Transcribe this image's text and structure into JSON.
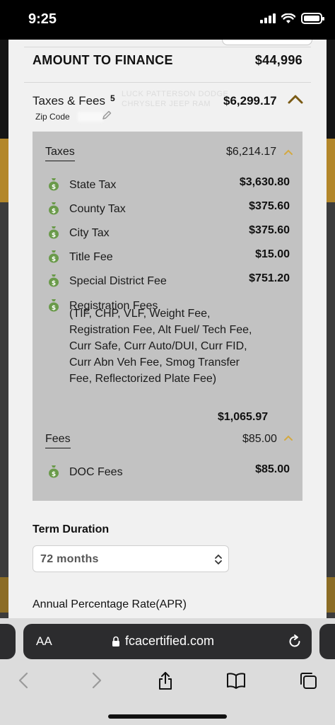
{
  "status_bar": {
    "time": "9:25"
  },
  "summary": {
    "amount_label": "AMOUNT TO FINANCE",
    "amount_value": "$44,996",
    "taxes_fees_label": "Taxes & Fees",
    "taxes_fees_count": "5",
    "taxes_fees_value": "$6,299.17",
    "zip_label": "Zip Code"
  },
  "taxes": {
    "label": "Taxes",
    "total": "$6,214.17",
    "items": [
      {
        "name": "State Tax",
        "amount": "$3,630.80"
      },
      {
        "name": "County Tax",
        "amount": "$375.60"
      },
      {
        "name": "City Tax",
        "amount": "$375.60"
      },
      {
        "name": "Title Fee",
        "amount": "$15.00"
      },
      {
        "name": "Special District Fee",
        "amount": "$751.20"
      }
    ],
    "registration": {
      "name": "Registration Fees",
      "description": "(TIF, CHP, VLF, Weight Fee, Registration Fee, Alt Fuel/ Tech Fee, Curr Safe, Curr Auto/DUI, Curr FID, Curr Abn Veh Fee, Smog Transfer Fee, Reflectorized Plate Fee)",
      "amount": "$1,065.97"
    }
  },
  "fees": {
    "label": "Fees",
    "total": "$85.00",
    "items": [
      {
        "name": "DOC Fees",
        "amount": "$85.00"
      }
    ]
  },
  "term": {
    "label": "Term Duration",
    "selected": "72 months"
  },
  "apr": {
    "label": "Annual Percentage Rate(APR)"
  },
  "browser": {
    "aa_label": "AA",
    "url": "fcacertified.com"
  },
  "colors": {
    "accent_gold": "#b3872a",
    "money_green": "#6a9a4a",
    "panel_grey": "#c2c2c2"
  }
}
